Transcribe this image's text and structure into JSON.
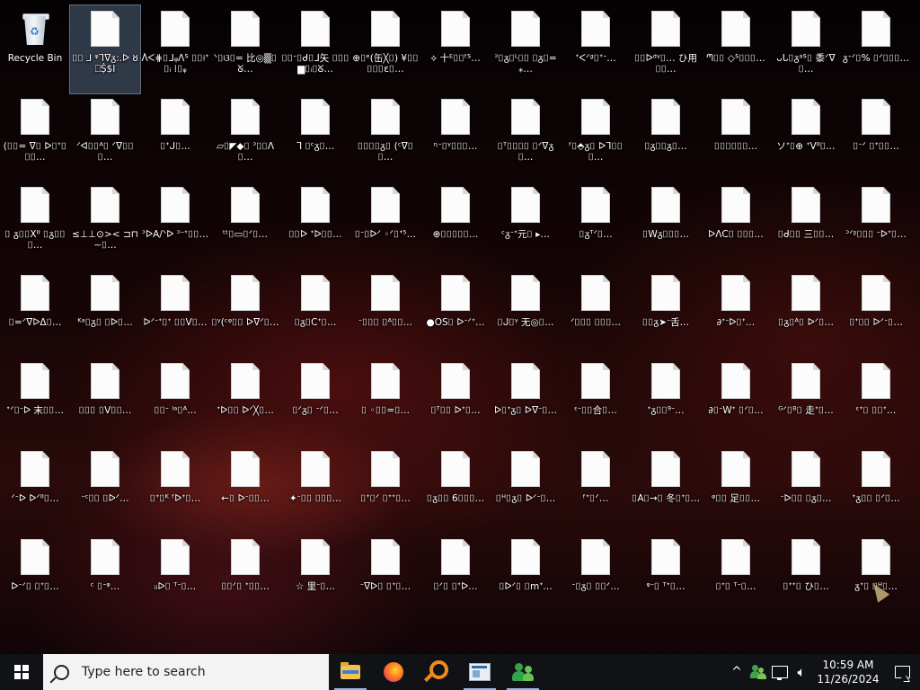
{
  "desktop": {
    "recycle_bin": {
      "label": "Recycle Bin",
      "icon": "recycle-bin-icon"
    },
    "files": [
      [
        "⌷⌷ ⅃ ᵠᒣᐁᵹ:.ᐅ ȣ⎕Ṩ$I",
        "ᐰᐸ⋕⌷ᒧᵩᐱᔆ ⌷⌷⟊ᐩ⌷ᵢ ⁞⌷ᵩ",
        "ᐠ⌷ଓ⌷= 比◎▒⌷ᘜ…",
        "⌷⌷ᐨ⌷ᑯ⌷ᒧ矢 ⌷⌷⌷▆⌷ᵢ⌷ᘜ…",
        "⊕⌷ᵉ(缶╳⌷) ¥⌷⌷⌷⌷⌷ε⌷…",
        "⟡ 十ᴱ⌷⌷ᶠᔆ…",
        "ᐣ⌷ᵹ⌷ᴸ⌷⌷ ⌷ᵹ⌷=⁎…",
        "ᐩᑈᐟᵍ⌷ᐩᐨ…",
        "⌷⌷ᐅᵈᵞ⌷…  ひ用⌷⌷…",
        "ᘉ⌷⌷ ◇ᔆ⌷⌷⌷…",
        "ᴗᒐ⌷ᵹᵃᔆ⌷ 黍ᐟᐁ⌷…",
        "ᵹᐨᐟ⌷% ⌷ᐟ⌷⌷⌷…"
      ],
      [
        "(⌷⌷= ᐁ⌷ ᐅ⌷ᐩ⌷⌷⌷…",
        "ᐟᐊ⌷⌷ᴬ⌷ ᐟᐁ⌷⌷⌷…",
        "⌷ᐩᒍ⌷…",
        "▱⌷◤◆⌷ ᐣ⌷⌷ᐱ⌷…",
        "ᒣ ⌷ᶜᵹ⌷…",
        "⌷⌷⌷⌷ᵹ⌷ (ᶜᐁ⌷⌷…",
        "ᶯᐨ⌷ᵞ⌷⌷⌷…",
        "⌷ᵀ⌷⌷⌷⌷ ⌷ᐟᐁᵹ⌷…",
        "ᶠ⌷⬘ᵹ⌷ ᐅᒣ⌷⌷⌷…",
        "⌷ᵹ⌷⌷ᵹ⌷…",
        "⌷⌷⌷⌷⌷⌷…",
        "ソᐩ⌷⊕ ᐩᐯᐦ⌷…",
        "⌷ᐨᐟ ⌷ᐩ⌷⌷…"
      ],
      [
        "⌷ ᵹ⌷⌷Xᐦ ⌷ᵹ⌷⌷⌷…",
        "≤⊥⊥⊙>< ⊐⊓∼⌷…",
        "ᐣᐅA/ᐠᐅ ᐣᐨᐩ⌷⌷…",
        "ᵗᵗ⌷▭⌷ᐟ⌷…",
        "⌷⌷ᐅ ᐩᐅ⌷⌷…",
        "⌷ᐨ⌷ᐅᐟ ◦ᐟ⌷ᐩ⁵…",
        "⊕⌷⌷⌷⌷⌷…",
        "ᶜᵹᐨᐩ元⌷ ▸…",
        "⌷ᵹᵀᐟ⌷…",
        "⌷Wᵹ⌷⌷⌷…",
        "ᐅᐱC⌷ ⌷⌷⌷…",
        "⌷ᑯ⌷⌷ 三⌷⌷…",
        "ᐣᐟᶳ⌷⌷⌷ ᐨᐅᐩ⌷…"
      ],
      [
        "⌷=ᐟᐁᐅᐃ⌷…",
        "ᴷᵃ⌷ᵹ⌷ ⌷ᐅ⌷…",
        "ᐅᐟᐨᐩ⌷ᐩ ⌷⌷ᐯ⌷…",
        "⌷ᵞ(ᶜᵠ⌷⌷ ᐅᐁᐟ⌷…",
        "⌷ᵹ⌷Cᐩ⌷…",
        "ᐨ⌷⌷⌷ ⌷ᴬ⌷⌷…",
        "●OS⌷ ᐅᐨᐟᐩ…",
        "⌷ᒍ⌷ᵞ 无◎⌷…",
        "ᐟ⌷⌷⌷ ⌷⌷⌷…",
        "⌷⌷ᵹ➤ᐨ舌…",
        "∂ᐩᐨᐅ⌷ᐩ…",
        "⌷ᵹ⌷ᴬ⌷ ᐅᐟ⌷…",
        "⌷ᐩ⌷⌷ ᐅᐟᐨ⌷…"
      ],
      [
        "ᐩᐟ⌷ᐨᐅ 末⌷⌷…",
        "⌷⌷⌷ ⌷ᐯ⌷⌷…",
        "⌷⌷ᐨ ᴵᵃ⌷ᴬ…",
        "ᐩᐅ⌷⌷ ᐅᐟ╳⌷…",
        "⌷ᐟᵹ⌷ ᐨᐟ⌷…",
        "⌷ ◦⌷⌷=⌷…",
        "⌷ᵀ⌷⌷ ᐅᐩ⌷…",
        "ᐅ⌷ᐩᵹ⌷ ᐅᐁᐨ⌷…",
        "ᵋᐨ⌷⌷合⌷…",
        "ᐩᵹ⌷⌷⁹ᐨ…",
        "∂⌷ᐨWᐩ ⌷ᐟ⌷…",
        "ᴳᐟ⌷ᴮ⌷ 走ᐩ⌷…",
        "ᵋᐩ⌷ ⌷⌷ᐩ…"
      ],
      [
        "ᐟᐨᐅ ᐅᐟᐦ⌷…",
        "ᐨᶜ⌷⌷ ⌷ᐅᐟ…",
        "⌷ᐩ⌷ᴷ ᶠᐅᐩ⌷…",
        "←⌷ ᐅᐨ⌷⌷…",
        "✦ᐨ⌷⌷ ⌷⌷⌷…",
        "⌷ᐩ⌷ᐟ ⌷ᐩᐩ⌷…",
        "⌷ᵹ⌷⌷ 6⌷⌷⌷…",
        "⌷ᴴ⌷ᵹ⌷ ᐅᐟᐨ⌷…",
        "ᶠᐩ⌷ᐟ…",
        "⌷A⌷→⌷ 冬⌷ᐩ⌷…",
        "ᵠ⌷⌷ 足⌷⌷…",
        "ᐨᐅ⌷⌷ ⌷ᵹ⌷…",
        "ᐩᵹ⌷⌷ ⌷ᐟ⌷…"
      ],
      [
        "ᐅᐨᐟ⌷ ⌷ᐩ⌷…",
        "ᶜ ⌷ᐨᵠ…",
        "ᵢᵢᐅ⌷ ᵀᐨ⌷…",
        "⌷⌷ᐟ⌷ ᐩ⌷⌷…",
        "☆ 里ᐨ⌷…",
        "ᐨᐁᐅ⌷ ⌷ᐩ⌷…",
        "⌷ᐟ⌷ ⌷ᐩᐅ…",
        "⌷ᐅᐟ⌷ ⌷mᐩ…",
        "ᐨ⌷ᵹ⌷ ⌷⌷ᐟ…",
        "ᵠᐨ⌷ ᵀᐩ⌷…",
        "⌷ᐩ⌷ ᵀᐨ⌷…",
        "⌷ᐩᐩ⌷ ひ⌷…",
        "ᵹᐩ⌷ ⌷ᴴ⌷…"
      ]
    ]
  },
  "taskbar": {
    "start_icon": "windows-logo-icon",
    "search_placeholder": "Type here to search",
    "pinned": [
      {
        "name": "file-explorer",
        "icon": "folder-icon"
      },
      {
        "name": "firefox",
        "icon": "firefox-icon"
      },
      {
        "name": "search-app",
        "icon": "magnifier-icon"
      },
      {
        "name": "app-window",
        "icon": "window-icon"
      },
      {
        "name": "people-app",
        "icon": "people-icon"
      }
    ],
    "tray": {
      "chevron": "^",
      "time": "10:59 AM",
      "date": "11/26/2024"
    }
  }
}
